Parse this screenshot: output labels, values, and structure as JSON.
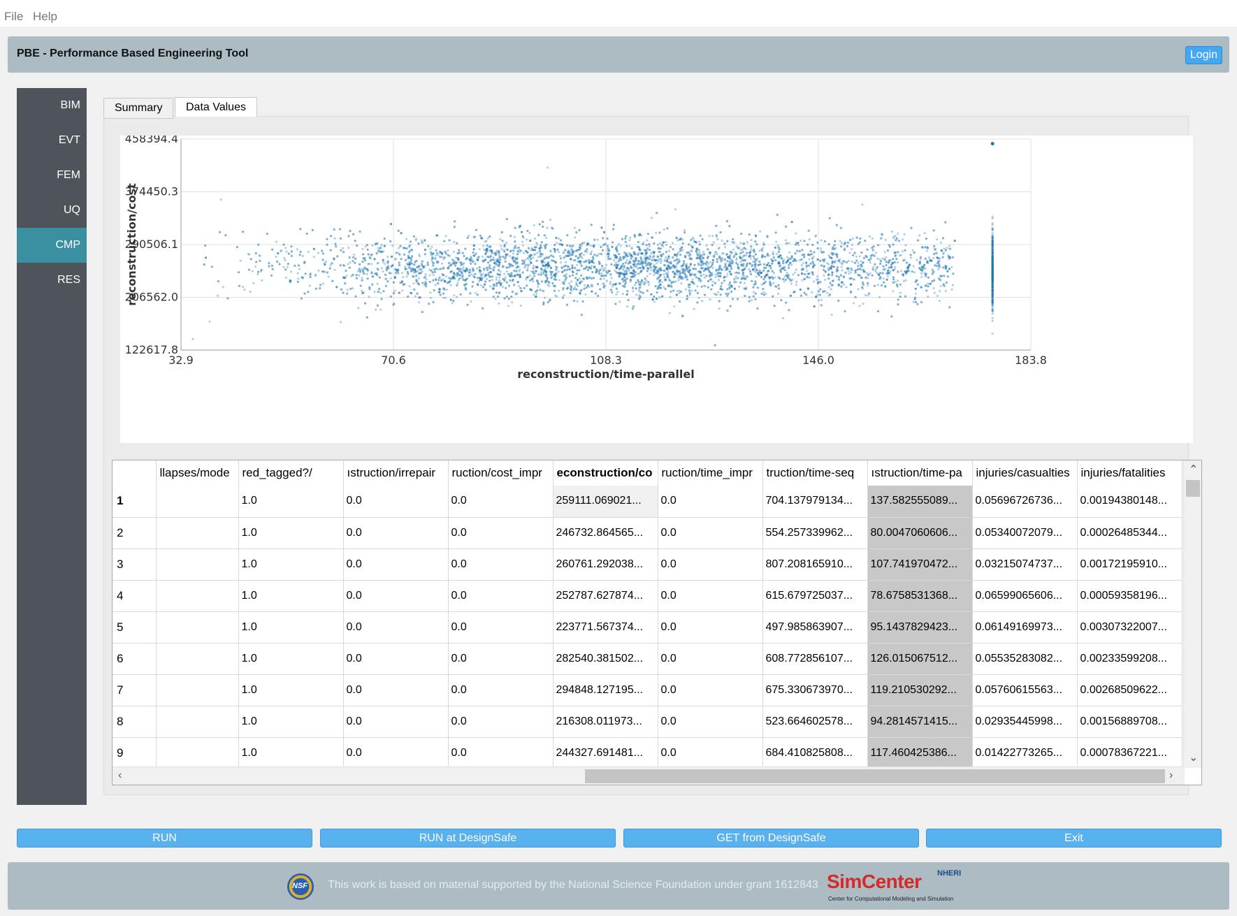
{
  "menubar": {
    "items": [
      "File",
      "Help"
    ]
  },
  "header": {
    "title": "PBE - Performance Based Engineering Tool",
    "login_label": "Login"
  },
  "sidebar": {
    "items": [
      {
        "label": "BIM"
      },
      {
        "label": "EVT"
      },
      {
        "label": "FEM"
      },
      {
        "label": "UQ"
      },
      {
        "label": "CMP",
        "active": true
      },
      {
        "label": "RES"
      }
    ]
  },
  "tabs": [
    {
      "label": "Summary",
      "active": false
    },
    {
      "label": "Data Values",
      "active": true
    }
  ],
  "chart_data": {
    "type": "scatter",
    "xlabel": "reconstruction/time-parallel",
    "ylabel": "reconstruction/cost",
    "xlim": [
      32.9,
      183.8
    ],
    "ylim": [
      122617.8,
      458394.4
    ],
    "xticks": [
      "32.9",
      "70.6",
      "108.3",
      "146.0",
      "183.8"
    ],
    "yticks": [
      "122617.8",
      "206562.0",
      "290506.1",
      "374450.3",
      "458394.4"
    ],
    "grid": true,
    "color": "#1f77b4",
    "description_points": {
      "cluster_center": {
        "x": 95,
        "y": 255000
      },
      "cap_column_x": 177,
      "outliers": [
        {
          "x": 177,
          "y": 451000
        },
        {
          "x": 98,
          "y": 413000
        },
        {
          "x": 40,
          "y": 362000
        },
        {
          "x": 35,
          "y": 140000
        },
        {
          "x": 38,
          "y": 168000
        }
      ]
    },
    "points": []
  },
  "table": {
    "columns": [
      "llapses/mode",
      "red_tagged?/",
      "ıstruction/irrepair",
      "ruction/cost_impr",
      "econstruction/co",
      "ruction/time_impr",
      "truction/time-seq",
      "ıstruction/time-pa",
      "injuries/casualties",
      "injuries/fatalities"
    ],
    "selected_column": 4,
    "rows": [
      {
        "n": "1",
        "cells": [
          "",
          "1.0",
          "0.0",
          "0.0",
          "259111.069021...",
          "0.0",
          "704.137979134...",
          "137.582555089...",
          "0.05696726736...",
          "0.00194380148..."
        ]
      },
      {
        "n": "2",
        "cells": [
          "",
          "1.0",
          "0.0",
          "0.0",
          "246732.864565...",
          "0.0",
          "554.257339962...",
          "80.0047060606...",
          "0.05340072079...",
          "0.00026485344..."
        ]
      },
      {
        "n": "3",
        "cells": [
          "",
          "1.0",
          "0.0",
          "0.0",
          "260761.292038...",
          "0.0",
          "807.208165910...",
          "107.741970472...",
          "0.03215074737...",
          "0.00172195910..."
        ]
      },
      {
        "n": "4",
        "cells": [
          "",
          "1.0",
          "0.0",
          "0.0",
          "252787.627874...",
          "0.0",
          "615.679725037...",
          "78.6758531368...",
          "0.06599065606...",
          "0.00059358196..."
        ]
      },
      {
        "n": "5",
        "cells": [
          "",
          "1.0",
          "0.0",
          "0.0",
          "223771.567374...",
          "0.0",
          "497.985863907...",
          "95.1437829423...",
          "0.06149169973...",
          "0.00307322007..."
        ]
      },
      {
        "n": "6",
        "cells": [
          "",
          "1.0",
          "0.0",
          "0.0",
          "282540.381502...",
          "0.0",
          "608.772856107...",
          "126.015067512...",
          "0.05535283082...",
          "0.00233599208..."
        ]
      },
      {
        "n": "7",
        "cells": [
          "",
          "1.0",
          "0.0",
          "0.0",
          "294848.127195...",
          "0.0",
          "675.330673970...",
          "119.210530292...",
          "0.05760615563...",
          "0.00268509622..."
        ]
      },
      {
        "n": "8",
        "cells": [
          "",
          "1.0",
          "0.0",
          "0.0",
          "216308.011973...",
          "0.0",
          "523.664602578...",
          "94.2814571415...",
          "0.02935445998...",
          "0.00156889708..."
        ]
      },
      {
        "n": "9",
        "cells": [
          "",
          "1.0",
          "0.0",
          "0.0",
          "244327.691481...",
          "0.0",
          "684.410825808...",
          "117.460425386...",
          "0.01422773265...",
          "0.00078367221..."
        ]
      }
    ]
  },
  "buttons": {
    "run": "RUN",
    "run_designsafe": "RUN at DesignSafe",
    "get_designsafe": "GET from DesignSafe",
    "exit": "Exit"
  },
  "footer": {
    "text": "This work is based on material supported by the National Science Foundation under grant 1612843",
    "nsf_label": "NSF",
    "logo_name": "SimCenter",
    "logo_badge": "NHERI",
    "logo_sub": "Center for Computational Modeling and Simulation"
  },
  "colors": {
    "accent": "#58b2f0",
    "header_bg": "#adbcc2",
    "sidebar_bg": "#4f535a",
    "sidebar_active": "#3a8fa0",
    "point": "#1f77b4"
  }
}
